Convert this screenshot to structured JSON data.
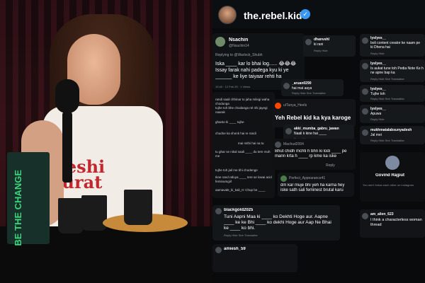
{
  "profile": {
    "handle": "the.rebel.kid",
    "verified_glyph": "✓"
  },
  "photo": {
    "shirt_text": "Deshi\naurat",
    "box_text": "BE THE CHANGE"
  },
  "tweet": {
    "name": "Nsachin",
    "user": "@Nsachin14",
    "replying": "Replying to @Warlock_Shubh",
    "body": "Iska ____ kar lo bhai log...... 😂😂😂 Issay farak nahi padega kyu ki ye ______ ke liye taiyaar rehti ha",
    "meta": "10:40 · 12 Feb 25 · 1 Views"
  },
  "comments": [
    {
      "id": "dhanvshl",
      "user": "dhanvshl",
      "text": "ki rani",
      "time": "7w",
      "actions": "Reply  Hide"
    },
    {
      "id": "lyslyes1",
      "user": "lyslyes__",
      "text": "boli content creator ke naam pe ki Dhena hai",
      "time": "3w",
      "actions": "Reply  Hide"
    },
    {
      "id": "lyslyes2",
      "user": "lyslyes__",
      "text": "Is aukat tune toh Pedia Note Ke h ne apne bap ka",
      "time": "3w",
      "actions": "Reply  Hide  See Translation"
    },
    {
      "id": "lyslyes3",
      "user": "lyslyes__",
      "text": "Tujhe toh",
      "time": "3w",
      "actions": "Reply  Hide  See Translation"
    },
    {
      "id": "lyslyes4",
      "user": "lyslyes__",
      "text": "Apuwa",
      "time": "3w",
      "actions": "Reply  Hide"
    },
    {
      "id": "mukh",
      "user": "mukhmatalabsunyadesh",
      "text": "Jal mei",
      "time": "15w",
      "actions": "Reply  Hide  See Translation"
    },
    {
      "id": "aruan",
      "user": "_aruan0290",
      "text": "hai mai aaya",
      "time": "7w",
      "actions": "Reply  Hide  See Translation"
    },
    {
      "id": "tanya",
      "user": "u/Tanya_Heels",
      "text": "Yeh Rebel kid ka kya karoge",
      "time": "",
      "actions": ""
    },
    {
      "id": "akki",
      "user": "akki_mumba_gabru_jawan",
      "text": "Naali k kine hai ____",
      "time": "7w",
      "actions": "Reply  Hide"
    },
    {
      "id": "machud",
      "user": "Machud2004",
      "text": "Bhut chidh mchti h bhn ki lodi ____ pe mann krta h ____ rp kme ka iske",
      "time": "2d",
      "actions": "Reply"
    },
    {
      "id": "perfect",
      "user": "Perfect_Appearance41",
      "text": "dm kar muje bhi yeh ha karna hey iske sath sali feminest brutal karu",
      "time": "2d",
      "actions": ""
    },
    {
      "id": "gaurav",
      "user": "Govind Rajput",
      "text": "You don't follow each other on Instagram",
      "time": "",
      "actions": ""
    },
    {
      "id": "blackgold",
      "user": "blackgold2025",
      "text": "Tuni Aapni Maa ki ____ ko Dekhti Hoge aur. Aapne ____ ke ke Bhi ____ ko dekhi Hoge aur Aap Ne Bhai ke ____ ko bhi.",
      "time": "7w",
      "actions": "Reply  Hide  See Translation"
    },
    {
      "id": "am_alien",
      "user": "am_alien_623",
      "text": "I think a characterless woman thread",
      "time": "4w",
      "actions": ""
    },
    {
      "id": "amiesh",
      "user": "amiesh_59",
      "text": "",
      "time": "1w",
      "actions": ""
    }
  ],
  "left_chat": [
    "randi saali chhinar to jaha milegi waha chodunga",
    "tujhe toh bhe chodanga rel nhi jayegi naarak",
    "ghanto ki ____ tujhe",
    "chudne ka shonk hai re randi",
    "mai mithi hai na tu",
    "tu ghar se nikal saali ____ du tere muh me",
    "tujhe toh jail me bhi chodenge",
    "Ikne rand rafuya ____ tere se lowai acid feminumgirl",
    "aamavale_ki_kali_rt: Chup be ____"
  ],
  "colors": {
    "accent": "#3897f0",
    "shirt_text": "#c1272d",
    "box_text": "#3cd57a"
  }
}
